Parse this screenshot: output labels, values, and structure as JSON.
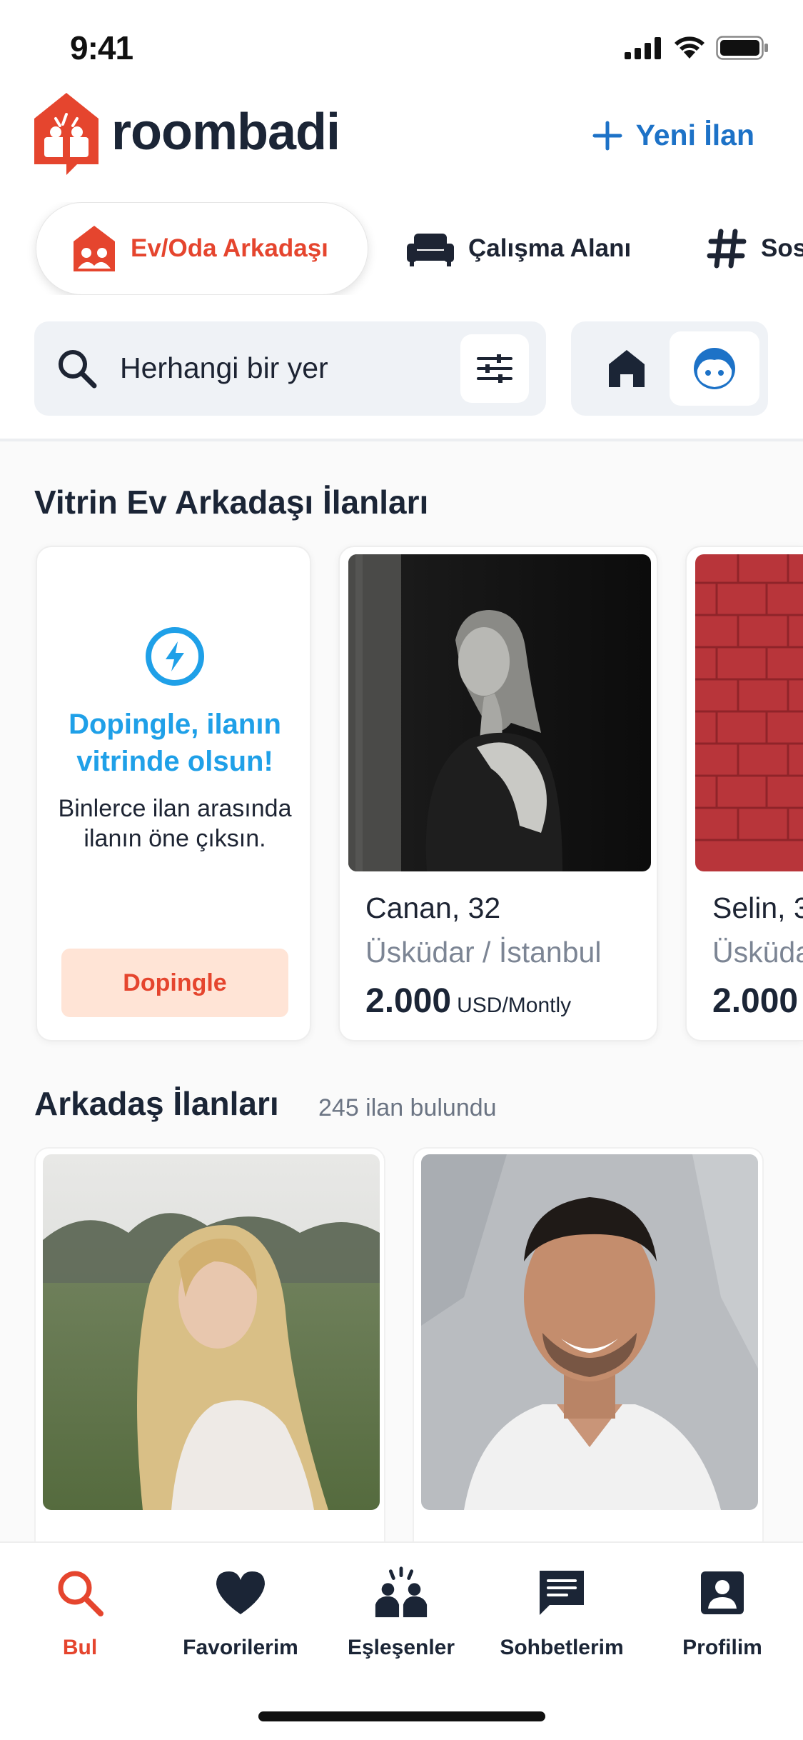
{
  "status_bar": {
    "time": "9:41"
  },
  "brand": {
    "name": "roombadi",
    "accent": "#E5452E",
    "link": "#1D72C7"
  },
  "header": {
    "new_listing": "Yeni İlan"
  },
  "tabs": [
    {
      "label": "Ev/Oda Arkadaşı",
      "icon": "roommates-house-icon",
      "active": true
    },
    {
      "label": "Çalışma Alanı",
      "icon": "sofa-icon",
      "active": false
    },
    {
      "label": "Sosyal",
      "icon": "hashtag-icon",
      "active": false
    }
  ],
  "search": {
    "placeholder": "Herhangi bir yer"
  },
  "featured": {
    "title": "Vitrin Ev Arkadaşı İlanları",
    "promo": {
      "title": "Dopingle, ilanın vitrinde olsun!",
      "body": "Binlerce ilan arasında ilanın öne çıksın.",
      "button": "Dopingle"
    },
    "cards": [
      {
        "name": "Canan, 32",
        "location": "Üsküdar / İstanbul",
        "price": "2.000",
        "unit": "USD/Montly"
      },
      {
        "name": "Selin, 3",
        "location": "Üsküda",
        "price": "2.000",
        "unit": ""
      }
    ]
  },
  "listings": {
    "title": "Arkadaş İlanları",
    "count_text": "245 ilan bulundu"
  },
  "nav": [
    {
      "label": "Bul",
      "icon": "search-icon",
      "active": true
    },
    {
      "label": "Favorilerim",
      "icon": "heart-icon",
      "active": false
    },
    {
      "label": "Eşleşenler",
      "icon": "match-icon",
      "active": false
    },
    {
      "label": "Sohbetlerim",
      "icon": "chat-icon",
      "active": false
    },
    {
      "label": "Profilim",
      "icon": "profile-icon",
      "active": false
    }
  ]
}
